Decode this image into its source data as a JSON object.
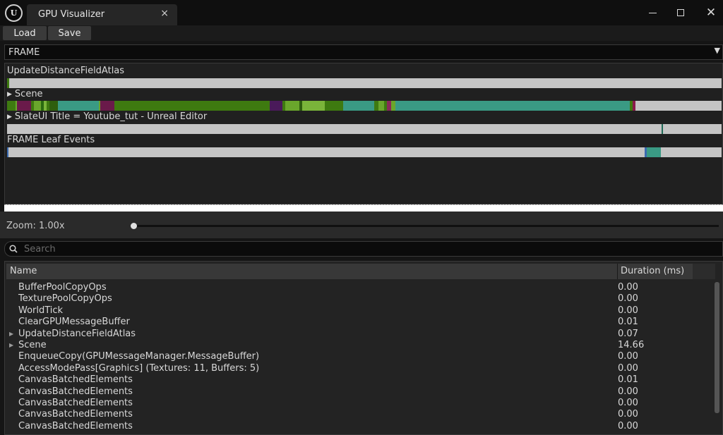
{
  "window": {
    "tab_title": "GPU Visualizer",
    "tab_close": "×",
    "minimize_icon": "window-minimize-icon",
    "maximize_icon": "window-maximize-icon",
    "close_glyph": "✕"
  },
  "toolbar": {
    "load_label": "Load",
    "save_label": "Save"
  },
  "frame_select": {
    "value": "FRAME",
    "arrow": "▼"
  },
  "tracks": [
    {
      "label": "UpdateDistanceFieldAtlas",
      "expandable": false
    },
    {
      "label": "Scene",
      "expandable": true
    },
    {
      "label": "SlateUI Title = Youtube_tut - Unreal Editor",
      "expandable": true
    },
    {
      "label": "FRAME Leaf Events",
      "expandable": false
    }
  ],
  "colors": {
    "bar_bg": "#c4c4c4",
    "green": "#3e7a10",
    "teal": "#3a9a84",
    "purple": "#6a1a4a",
    "light_green": "#6aa62c",
    "blue": "#3a6ab0"
  },
  "zoom": {
    "label": "Zoom: 1.00x",
    "value": 1.0
  },
  "search": {
    "placeholder": "Search"
  },
  "table": {
    "columns": [
      "Name",
      "Duration (ms)"
    ],
    "rows": [
      {
        "name": "BufferPoolCopyOps",
        "duration": "0.00",
        "expandable": false
      },
      {
        "name": "TexturePoolCopyOps",
        "duration": "0.00",
        "expandable": false
      },
      {
        "name": "WorldTick",
        "duration": "0.00",
        "expandable": false
      },
      {
        "name": "ClearGPUMessageBuffer",
        "duration": "0.01",
        "expandable": false
      },
      {
        "name": "UpdateDistanceFieldAtlas",
        "duration": "0.07",
        "expandable": true
      },
      {
        "name": "Scene",
        "duration": "14.66",
        "expandable": true
      },
      {
        "name": "EnqueueCopy(GPUMessageManager.MessageBuffer)",
        "duration": "0.00",
        "expandable": false
      },
      {
        "name": "AccessModePass[Graphics] (Textures: 11, Buffers: 5)",
        "duration": "0.00",
        "expandable": false
      },
      {
        "name": "CanvasBatchedElements",
        "duration": "0.01",
        "expandable": false
      },
      {
        "name": "CanvasBatchedElements",
        "duration": "0.00",
        "expandable": false
      },
      {
        "name": "CanvasBatchedElements",
        "duration": "0.00",
        "expandable": false
      },
      {
        "name": "CanvasBatchedElements",
        "duration": "0.00",
        "expandable": false
      },
      {
        "name": "CanvasBatchedElements",
        "duration": "0.00",
        "expandable": false
      }
    ]
  }
}
